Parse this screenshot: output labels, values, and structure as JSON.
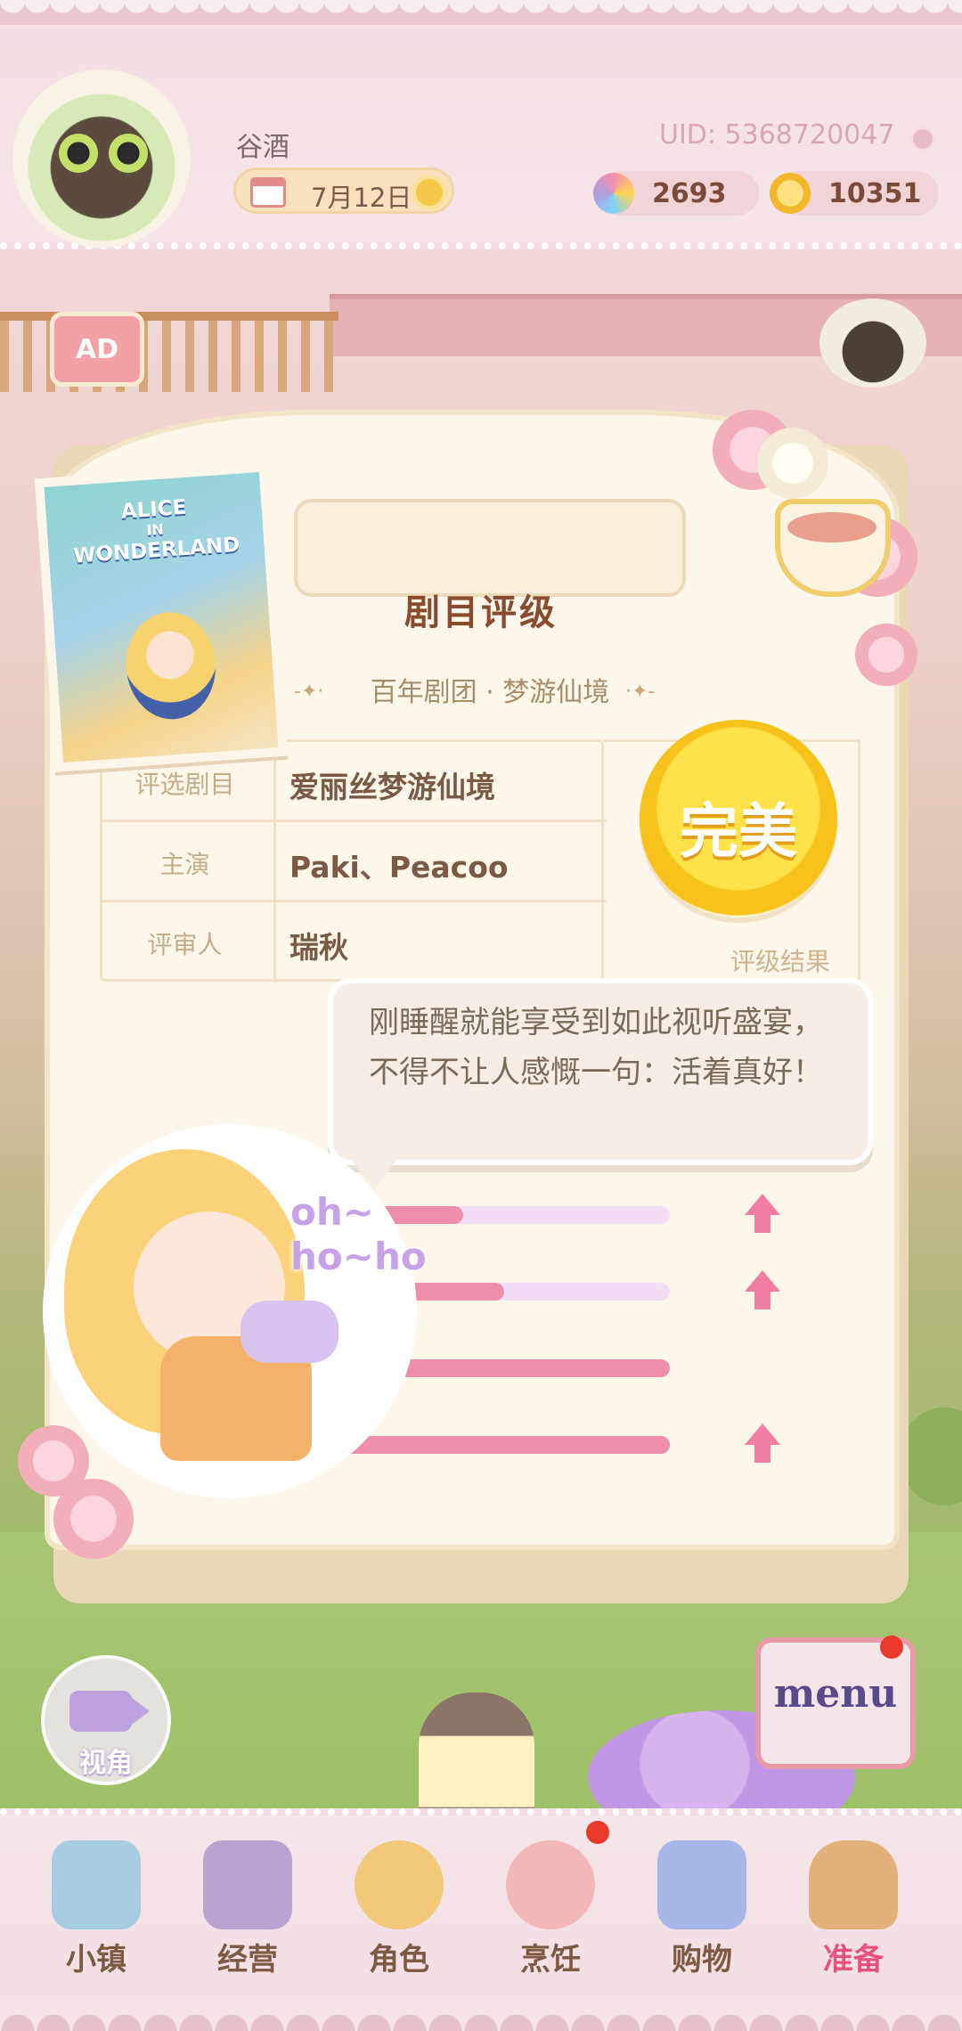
{
  "header": {
    "player_name": "谷酒",
    "date": "7月12日",
    "uid": "UID: 5368720047",
    "currencies": [
      {
        "icon": "rainbow-star-icon",
        "value": "2693",
        "color": "#c89ae8"
      },
      {
        "icon": "gold-coin-icon",
        "value": "10351",
        "color": "#f2b82a"
      }
    ]
  },
  "ad_badge": {
    "label": "AD"
  },
  "rating_card": {
    "title": "剧目评级",
    "subtitle": "百年剧团 · 梦游仙境",
    "rows": [
      {
        "label": "评选剧目",
        "value": "爱丽丝梦游仙境"
      },
      {
        "label": "主演",
        "value": "Paki、Peacoo"
      },
      {
        "label": "评审人",
        "value": "瑞秋"
      }
    ],
    "result": {
      "grade": "完美",
      "label": "评级结果"
    },
    "comment_line1": "刚睡醒就能享受到如此视听盛宴，",
    "comment_line2": "不得不让人感慨一句：活着真好！",
    "score_bars": [
      {
        "fill": 0.45,
        "arrow": true
      },
      {
        "fill": 0.56,
        "arrow": true
      },
      {
        "fill": 1.0,
        "arrow": false
      },
      {
        "fill": 1.0,
        "arrow": true
      }
    ]
  },
  "poster": {
    "title_line1": "ALICE",
    "title_line2": "IN",
    "title_line3": "WONDERLAND"
  },
  "character": {
    "exclaim_line1": "oh~",
    "exclaim_line2": "ho~ho"
  },
  "side_buttons": {
    "camera_label": "视角",
    "menu_label": "menu"
  },
  "bottom_nav": {
    "items": [
      {
        "label": "小镇",
        "icon": "map-icon",
        "color": "#a8cce0"
      },
      {
        "label": "经营",
        "icon": "locked-shop-icon",
        "color": "#b9a3cf"
      },
      {
        "label": "角色",
        "icon": "character-icon",
        "color": "#f3c878"
      },
      {
        "label": "烹饪",
        "icon": "sandwich-icon",
        "color": "#f4b7b9"
      },
      {
        "label": "购物",
        "icon": "shopping-bag-icon",
        "color": "#a9b6e8"
      },
      {
        "label": "准备",
        "icon": "picnic-basket-icon",
        "color": "#e3b27a"
      }
    ],
    "active_index": 5
  }
}
